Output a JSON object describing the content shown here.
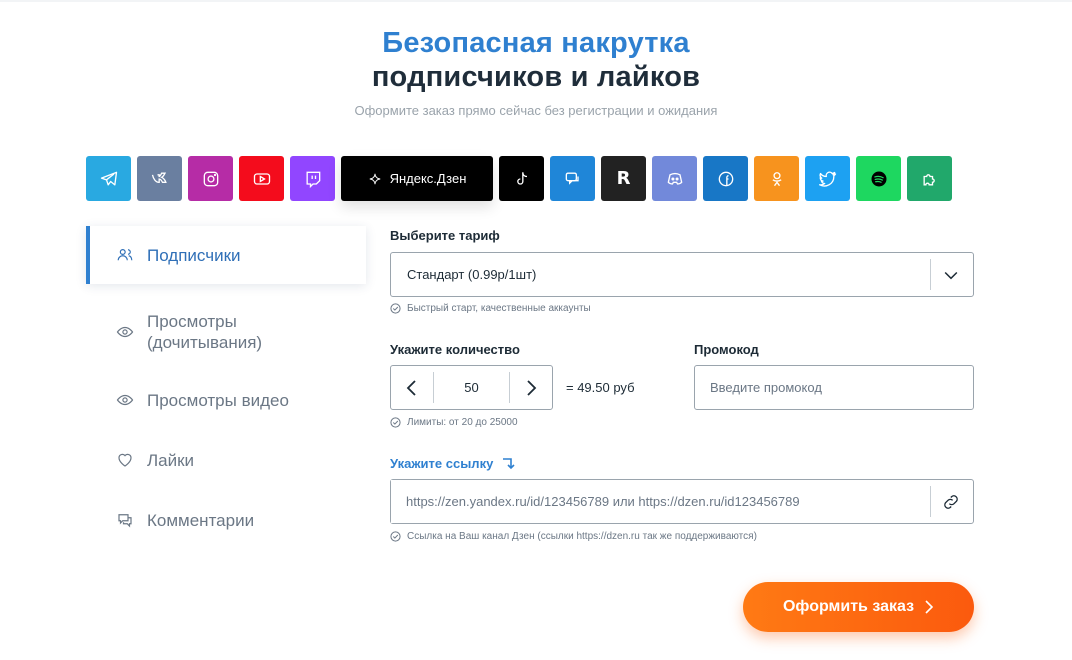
{
  "hero": {
    "title_line1": "Безопасная накрутка",
    "title_line2": "подписчиков и лайков",
    "subtitle": "Оформите заказ прямо сейчас без регистрации и ожидания"
  },
  "platforms": [
    {
      "icon": "telegram-icon",
      "color": "#29a9e1"
    },
    {
      "icon": "vk-icon",
      "color": "#6a7fa0"
    },
    {
      "icon": "instagram-icon",
      "color": "#b62ca6"
    },
    {
      "icon": "youtube-icon",
      "color": "#f40c1c"
    },
    {
      "icon": "twitch-icon",
      "color": "#9146ff"
    },
    {
      "icon": "sparkle-icon",
      "color": "#000000",
      "label": "Яндекс.Дзен",
      "active": true
    },
    {
      "icon": "tiktok-icon",
      "color": "#000000"
    },
    {
      "icon": "chat-icon",
      "color": "#1f86d8"
    },
    {
      "icon": "r-icon",
      "color": "#222222"
    },
    {
      "icon": "discord-icon",
      "color": "#7289da"
    },
    {
      "icon": "facebook-icon",
      "color": "#1877c6"
    },
    {
      "icon": "odnoklassniki-icon",
      "color": "#f7931e"
    },
    {
      "icon": "twitter-icon",
      "color": "#1da1f2"
    },
    {
      "icon": "spotify-icon",
      "color": "#1ed760"
    },
    {
      "icon": "puzzle-icon",
      "color": "#21a86b"
    }
  ],
  "nav": {
    "items": [
      {
        "label": "Подписчики",
        "icon": "users-icon",
        "active": true
      },
      {
        "label": "Просмотры (дочитывания)",
        "icon": "eye-icon"
      },
      {
        "label": "Просмотры видео",
        "icon": "eye-icon"
      },
      {
        "label": "Лайки",
        "icon": "heart-icon"
      },
      {
        "label": "Комментарии",
        "icon": "comments-icon"
      }
    ]
  },
  "form": {
    "tariff_label": "Выберите тариф",
    "tariff_value": "Стандарт (0.99р/1шт)",
    "tariff_hint": "Быстрый старт, качественные аккаунты",
    "quantity_label": "Укажите количество",
    "quantity_value": "50",
    "price": "= 49.50 руб",
    "quantity_hint": "Лимиты: от 20 до 25000",
    "promo_label": "Промокод",
    "promo_placeholder": "Введите промокод",
    "link_label": "Укажите ссылку",
    "link_placeholder": "https://zen.yandex.ru/id/123456789 или https://dzen.ru/id123456789",
    "link_hint": "Ссылка на Ваш канал Дзен (ссылки https://dzen.ru так же поддерживаются)",
    "submit_label": "Оформить заказ"
  },
  "colors": {
    "accent": "#2f80d0",
    "submit": "#fb6a12"
  }
}
